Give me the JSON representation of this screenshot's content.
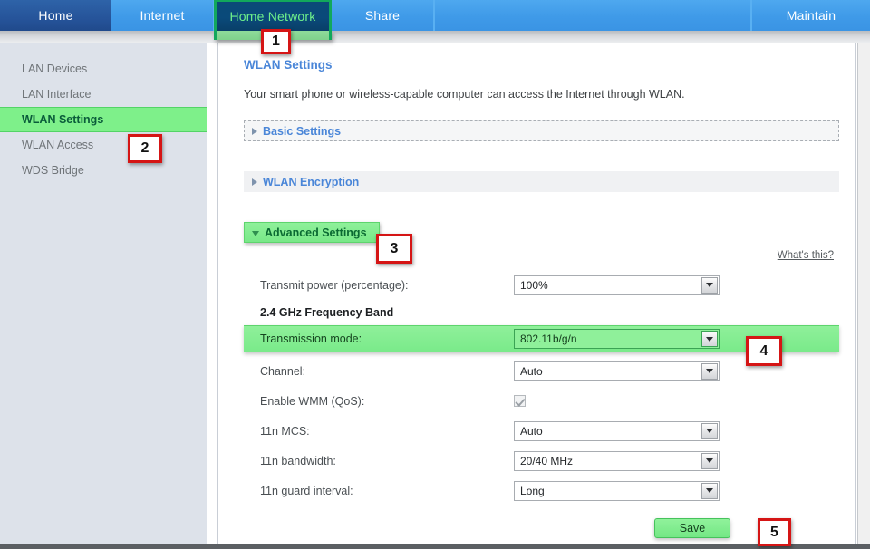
{
  "nav": {
    "tabs": [
      {
        "label": "Home",
        "state": "inactive"
      },
      {
        "label": "Internet",
        "state": "inactive"
      },
      {
        "label": "Home Network",
        "state": "active"
      },
      {
        "label": "Share",
        "state": "inactive"
      },
      {
        "label": "Maintain",
        "state": "inactive"
      }
    ]
  },
  "sidebar": {
    "items": [
      {
        "label": "LAN Devices",
        "selected": false
      },
      {
        "label": "LAN Interface",
        "selected": false
      },
      {
        "label": "WLAN Settings",
        "selected": true
      },
      {
        "label": "WLAN Access",
        "selected": false
      },
      {
        "label": "WDS Bridge",
        "selected": false
      }
    ]
  },
  "main": {
    "title": "WLAN Settings",
    "description": "Your smart phone or wireless-capable computer can access the Internet through WLAN.",
    "sections": [
      {
        "label": "Basic Settings",
        "expanded": false,
        "style": "dashed"
      },
      {
        "label": "WLAN Encryption",
        "expanded": false,
        "style": "flat"
      },
      {
        "label": "Advanced Settings",
        "expanded": true,
        "style": "greenhl"
      }
    ],
    "whats_this": "What's this?",
    "band_heading": "2.4 GHz Frequency Band",
    "fields": {
      "transmit_power": {
        "label": "Transmit power (percentage):",
        "value": "100%"
      },
      "transmission_mode": {
        "label": "Transmission mode:",
        "value": "802.11b/g/n"
      },
      "channel": {
        "label": "Channel:",
        "value": "Auto"
      },
      "enable_wmm": {
        "label": "Enable WMM (QoS):",
        "value": "checked"
      },
      "mcs": {
        "label": "11n MCS:",
        "value": "Auto"
      },
      "bandwidth": {
        "label": "11n bandwidth:",
        "value": "20/40 MHz"
      },
      "guard_interval": {
        "label": "11n guard interval:",
        "value": "Long"
      }
    },
    "save_label": "Save"
  },
  "callouts": {
    "one": "1",
    "two": "2",
    "three": "3",
    "four": "4",
    "five": "5"
  },
  "colors": {
    "nav_blue": "#3f9ae8",
    "nav_home_blue": "#26549a",
    "nav_active_navy": "#0a4a7a",
    "accent_green": "#7ef08a",
    "highlight_border_green": "#12a85c",
    "title_blue": "#4a86d8",
    "callout_red": "#d51515",
    "sidebar_bg": "#dde2ea"
  }
}
